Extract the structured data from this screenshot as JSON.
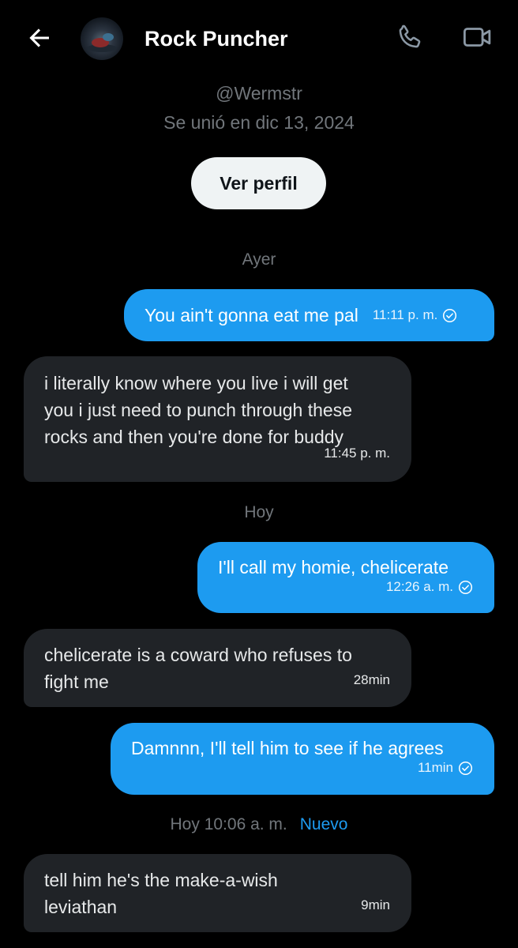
{
  "header": {
    "title": "Rock Puncher",
    "back_icon": "arrow-left-icon",
    "call_icon": "phone-icon",
    "video_icon": "video-camera-icon"
  },
  "profile": {
    "handle": "@Wermstr",
    "joined": "Se unió en dic 13, 2024",
    "view_profile_label": "Ver perfil"
  },
  "separators": {
    "yesterday": "Ayer",
    "today": "Hoy",
    "today_time": "Hoy 10:06 a. m.",
    "new_label": "Nuevo"
  },
  "messages": [
    {
      "direction": "outgoing",
      "text": "You ain't gonna eat me pal",
      "time": "11:11 p. m.",
      "read": true
    },
    {
      "direction": "incoming",
      "lines": [
        "i literally know where you live i will get",
        "you i just need to punch through these",
        "rocks and then you're done for buddy"
      ],
      "time": "11:45 p. m."
    },
    {
      "direction": "outgoing",
      "text": "I'll call my homie, chelicerate",
      "time": "12:26 a. m.",
      "read": true
    },
    {
      "direction": "incoming",
      "lines": [
        "chelicerate is a coward who refuses to",
        "fight me"
      ],
      "time": "28min"
    },
    {
      "direction": "outgoing",
      "text": "Damnnn, I'll tell him to see if he agrees",
      "time": "11min",
      "read": true
    },
    {
      "direction": "incoming",
      "lines": [
        "tell him he's the make-a-wish",
        "leviathan"
      ],
      "time": "9min"
    }
  ],
  "colors": {
    "background": "#000000",
    "outgoing_bubble": "#1d9bf0",
    "incoming_bubble": "#202327",
    "secondary_text": "#71767b",
    "accent": "#1d9bf0"
  }
}
